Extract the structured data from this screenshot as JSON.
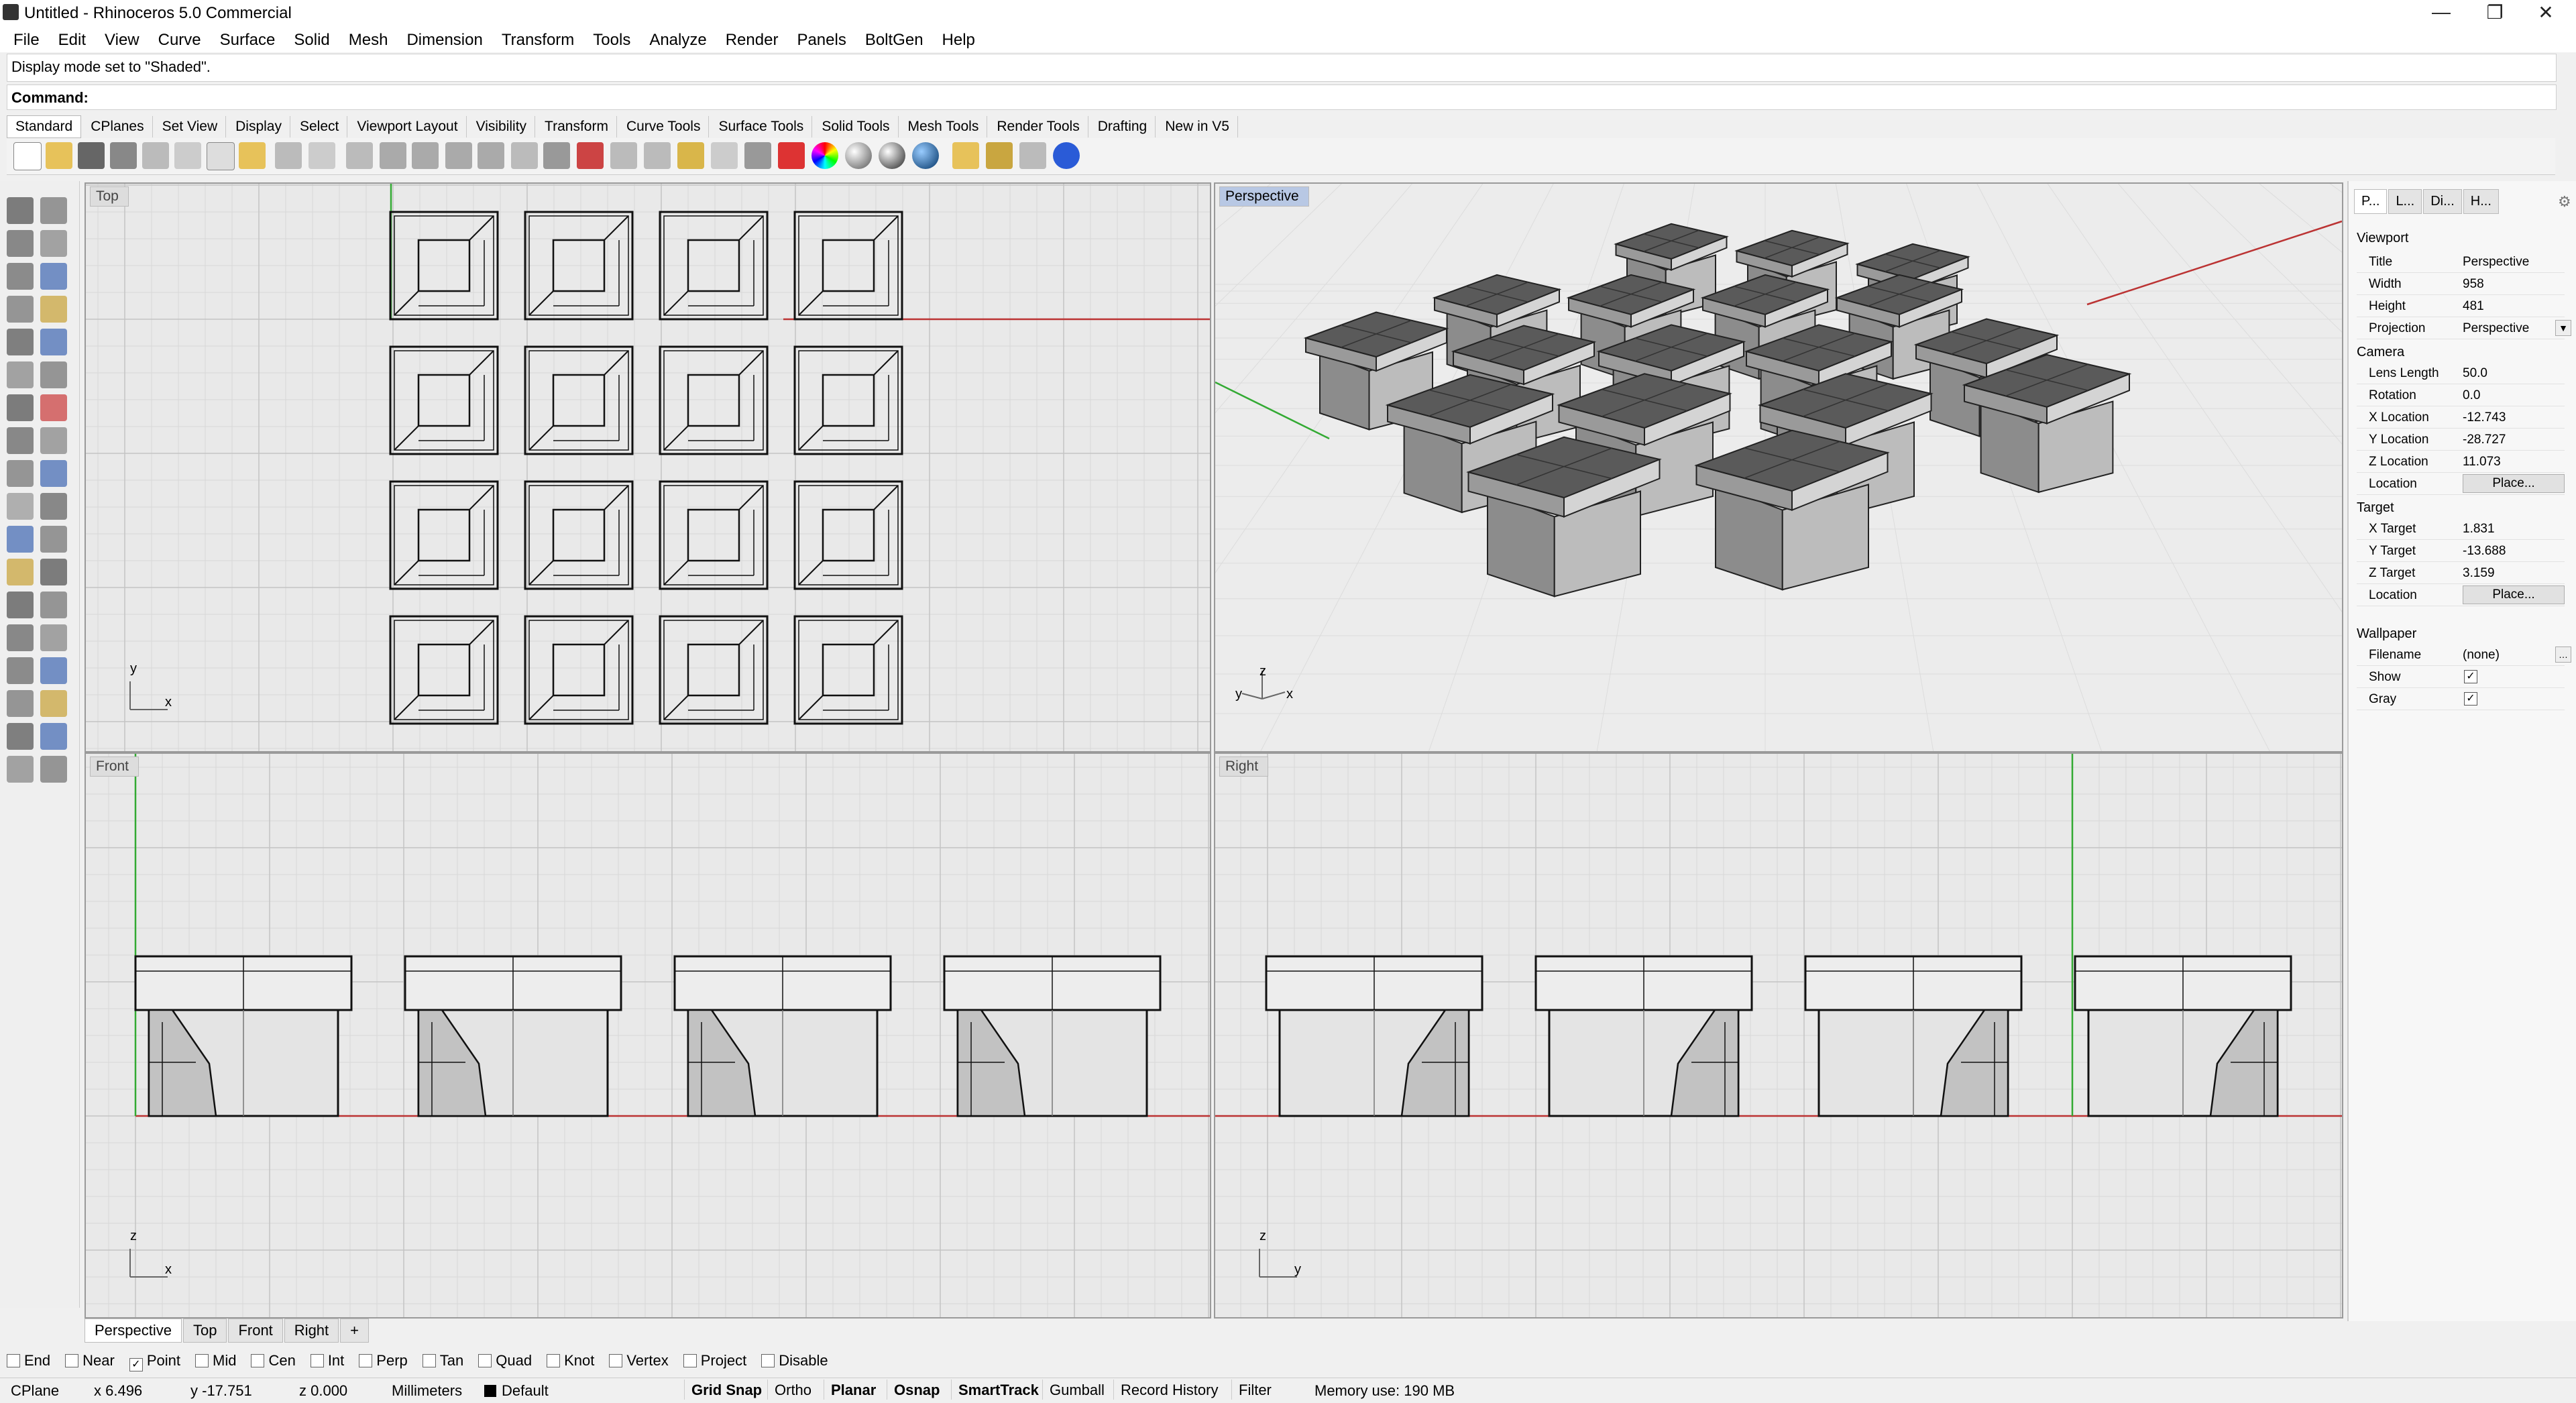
{
  "window": {
    "title": "Untitled - Rhinoceros 5.0 Commercial"
  },
  "menu": [
    "File",
    "Edit",
    "View",
    "Curve",
    "Surface",
    "Solid",
    "Mesh",
    "Dimension",
    "Transform",
    "Tools",
    "Analyze",
    "Render",
    "Panels",
    "BoltGen",
    "Help"
  ],
  "command": {
    "history": "Display mode set to \"Shaded\".",
    "prompt_label": "Command:",
    "value": ""
  },
  "toolbar_tabs": [
    "Standard",
    "CPlanes",
    "Set View",
    "Display",
    "Select",
    "Viewport Layout",
    "Visibility",
    "Transform",
    "Curve Tools",
    "Surface Tools",
    "Solid Tools",
    "Mesh Tools",
    "Render Tools",
    "Drafting",
    "New in V5"
  ],
  "viewports": {
    "top": {
      "label": "Top",
      "axis1": "y",
      "axis2": "x"
    },
    "perspective": {
      "label": "Perspective",
      "axis_z": "z",
      "axis_y": "y",
      "axis_x": "x"
    },
    "front": {
      "label": "Front",
      "axis1": "z",
      "axis2": "x"
    },
    "right": {
      "label": "Right",
      "axis1": "z",
      "axis2": "y"
    }
  },
  "viewport_tabs": [
    "Perspective",
    "Top",
    "Front",
    "Right",
    "+"
  ],
  "osnaps": [
    {
      "label": "End",
      "checked": false
    },
    {
      "label": "Near",
      "checked": false
    },
    {
      "label": "Point",
      "checked": true
    },
    {
      "label": "Mid",
      "checked": false
    },
    {
      "label": "Cen",
      "checked": false
    },
    {
      "label": "Int",
      "checked": false
    },
    {
      "label": "Perp",
      "checked": false
    },
    {
      "label": "Tan",
      "checked": false
    },
    {
      "label": "Quad",
      "checked": false
    },
    {
      "label": "Knot",
      "checked": false
    },
    {
      "label": "Vertex",
      "checked": false
    },
    {
      "label": "Project",
      "checked": false
    },
    {
      "label": "Disable",
      "checked": false
    }
  ],
  "status": {
    "cplane": "CPlane",
    "x": "x 6.496",
    "y": "y -17.751",
    "z": "z 0.000",
    "units": "Millimeters",
    "layer": "Default",
    "toggles": [
      {
        "label": "Grid Snap",
        "bold": true
      },
      {
        "label": "Ortho",
        "bold": false
      },
      {
        "label": "Planar",
        "bold": true
      },
      {
        "label": "Osnap",
        "bold": true
      },
      {
        "label": "SmartTrack",
        "bold": true
      },
      {
        "label": "Gumball",
        "bold": false
      },
      {
        "label": "Record History",
        "bold": false
      },
      {
        "label": "Filter",
        "bold": false
      }
    ],
    "memory": "Memory use: 190 MB"
  },
  "properties": {
    "tabs": [
      "P...",
      "L...",
      "Di...",
      "H..."
    ],
    "viewport_section": "Viewport",
    "title_label": "Title",
    "title": "Perspective",
    "width_label": "Width",
    "width": "958",
    "height_label": "Height",
    "height": "481",
    "projection_label": "Projection",
    "projection": "Perspective",
    "camera_section": "Camera",
    "lens_label": "Lens Length",
    "lens": "50.0",
    "rotation_label": "Rotation",
    "rotation": "0.0",
    "xloc_label": "X Location",
    "xloc": "-12.743",
    "yloc_label": "Y Location",
    "yloc": "-28.727",
    "zloc_label": "Z Location",
    "zloc": "11.073",
    "location_label": "Location",
    "place_button": "Place...",
    "target_section": "Target",
    "xt_label": "X Target",
    "xt": "1.831",
    "yt_label": "Y Target",
    "yt": "-13.688",
    "zt_label": "Z Target",
    "zt": "3.159",
    "tlocation_label": "Location",
    "tplace_button": "Place...",
    "wallpaper_section": "Wallpaper",
    "filename_label": "Filename",
    "filename": "(none)",
    "show_label": "Show",
    "show": true,
    "gray_label": "Gray",
    "gray": true
  }
}
